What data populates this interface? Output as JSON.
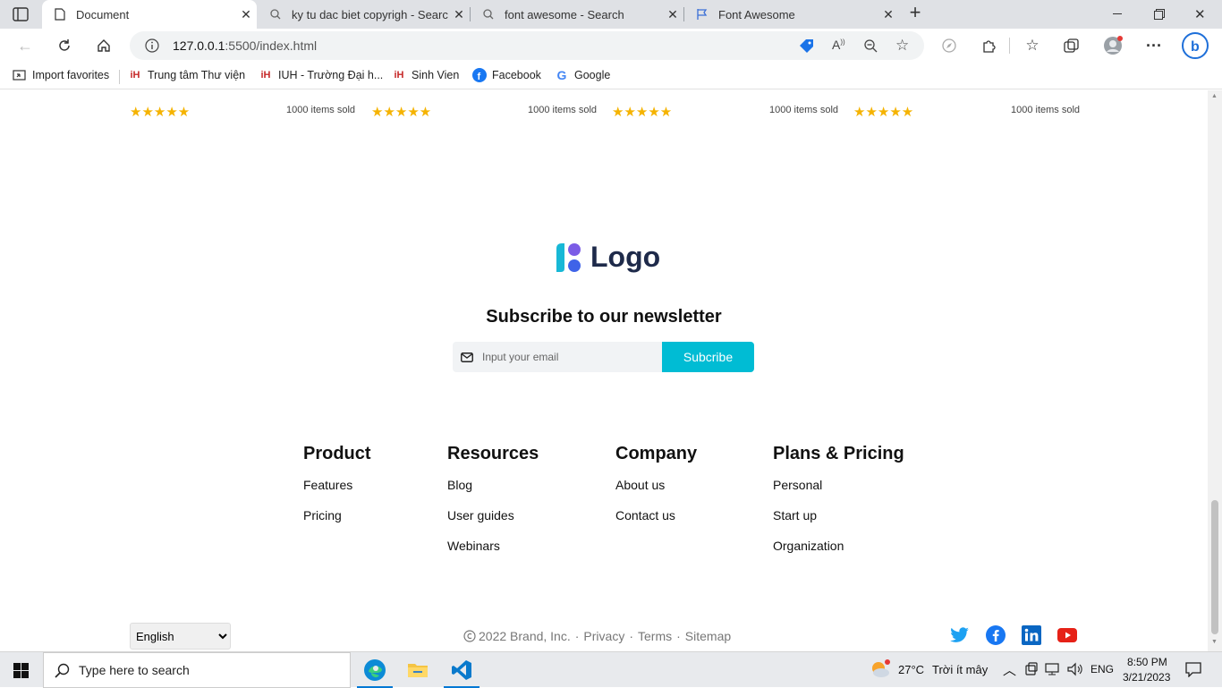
{
  "tabs": [
    {
      "label": "Document",
      "icon": "page-icon",
      "active": true
    },
    {
      "label": "ky tu dac biet copyrigh - Search",
      "icon": "search-icon",
      "active": false
    },
    {
      "label": "font awesome - Search",
      "icon": "search-icon",
      "active": false
    },
    {
      "label": "Font Awesome",
      "icon": "flag-icon",
      "active": false
    }
  ],
  "address": {
    "url_host": "127.0.0.1",
    "url_rest": ":5500/index.html"
  },
  "favorites": [
    {
      "label": "Import favorites",
      "icon": "import-icon"
    },
    {
      "label": "Trung tâm Thư viện",
      "icon": "iuh-icon"
    },
    {
      "label": "IUH - Trường Đại h...",
      "icon": "iuh-icon"
    },
    {
      "label": "Sinh Vien",
      "icon": "iuh-icon"
    },
    {
      "label": "Facebook",
      "icon": "facebook-icon"
    },
    {
      "label": "Google",
      "icon": "google-icon"
    }
  ],
  "products_row": {
    "stars": "★★★★★",
    "sold_text": "1000 items sold",
    "star_rating": 5
  },
  "logo": {
    "text": "Logo"
  },
  "newsletter": {
    "title": "Subscribe to our newsletter",
    "email_placeholder": "Input your email",
    "button_label": "Subcribe"
  },
  "footer_columns": [
    {
      "title": "Product",
      "links": [
        "Features",
        "Pricing"
      ]
    },
    {
      "title": "Resources",
      "links": [
        "Blog",
        "User guides",
        "Webinars"
      ]
    },
    {
      "title": "Company",
      "links": [
        "About us",
        "Contact us"
      ]
    },
    {
      "title": "Plans & Pricing",
      "links": [
        "Personal",
        "Start up",
        "Organization"
      ]
    }
  ],
  "bottom": {
    "language": "English",
    "copyright": "2022 Brand, Inc.",
    "sep": "·",
    "privacy": "Privacy",
    "terms": "Terms",
    "sitemap": "Sitemap",
    "social": [
      "twitter-icon",
      "facebook-icon",
      "linkedin-icon",
      "youtube-icon"
    ]
  },
  "taskbar": {
    "search_placeholder": "Type here to search",
    "weather_temp": "27°C",
    "weather_text": "Trời ít mây",
    "lang": "ENG",
    "time": "8:50 PM",
    "date": "3/21/2023"
  },
  "colors": {
    "accent": "#00bcd4",
    "star": "#f5b301",
    "taskbar_accent": "#0078d4"
  }
}
